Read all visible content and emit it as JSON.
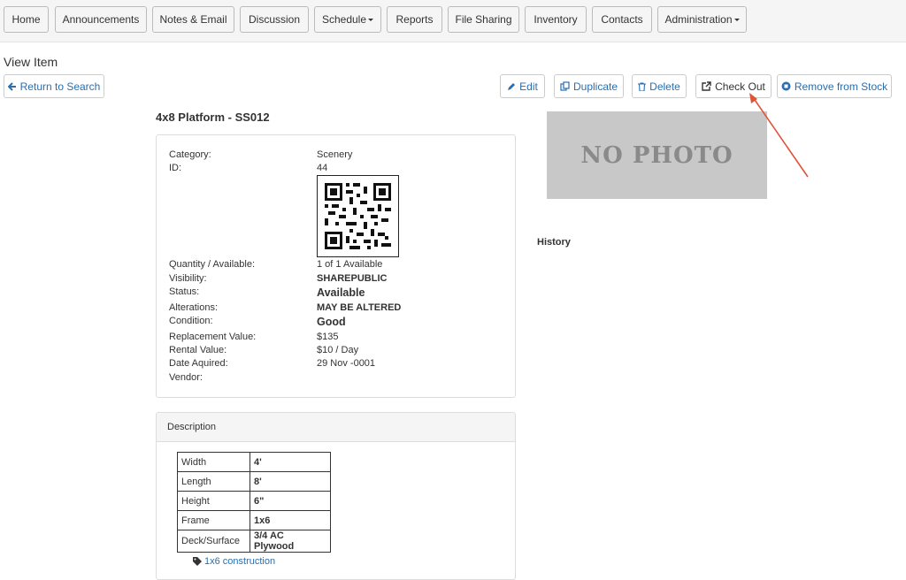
{
  "nav": {
    "items": [
      {
        "label": "Home"
      },
      {
        "label": "Announcements"
      },
      {
        "label": "Notes & Email"
      },
      {
        "label": "Discussion"
      },
      {
        "label": "Schedule"
      },
      {
        "label": "Reports"
      },
      {
        "label": "File Sharing"
      },
      {
        "label": "Inventory"
      },
      {
        "label": "Contacts"
      },
      {
        "label": "Administration"
      }
    ]
  },
  "page": {
    "title": "View Item"
  },
  "actions": {
    "return": "Return to Search",
    "edit": "Edit",
    "duplicate": "Duplicate",
    "delete": "Delete",
    "checkout": "Check Out",
    "remove": "Remove from Stock"
  },
  "item": {
    "title": "4x8 Platform - SS012",
    "fields": [
      {
        "label": "Category:",
        "value": "Scenery"
      },
      {
        "label": "ID:",
        "value": "44"
      },
      {
        "label": "Quantity / Available:",
        "value": "1 of 1 Available"
      },
      {
        "label": "Visibility:",
        "value": "SHAREPUBLIC"
      },
      {
        "label": "Status:",
        "value": "Available"
      },
      {
        "label": "Alterations:",
        "value": "MAY BE ALTERED"
      },
      {
        "label": "Condition:",
        "value": "Good"
      },
      {
        "label": "Replacement Value:",
        "value": "$135"
      },
      {
        "label": "Rental Value:",
        "value": "$10 / Day"
      },
      {
        "label": "Date Aquired:",
        "value": "29 Nov -0001"
      },
      {
        "label": "Vendor:",
        "value": ""
      }
    ]
  },
  "description": {
    "heading": "Description",
    "rows": [
      {
        "k": "Width",
        "v": "4'"
      },
      {
        "k": "Length",
        "v": "8'"
      },
      {
        "k": "Height",
        "v": "6\""
      },
      {
        "k": "Frame",
        "v": "1x6"
      },
      {
        "k": "Deck/Surface",
        "v": "3/4 AC Plywood"
      }
    ],
    "tag": "1x6 construction"
  },
  "photo": {
    "placeholder": "NO PHOTO"
  },
  "history": {
    "title": "History"
  },
  "colors": {
    "link": "#2a6eb0",
    "annotation_arrow": "#e0533a",
    "photo_bg": "#c8c8c8"
  }
}
